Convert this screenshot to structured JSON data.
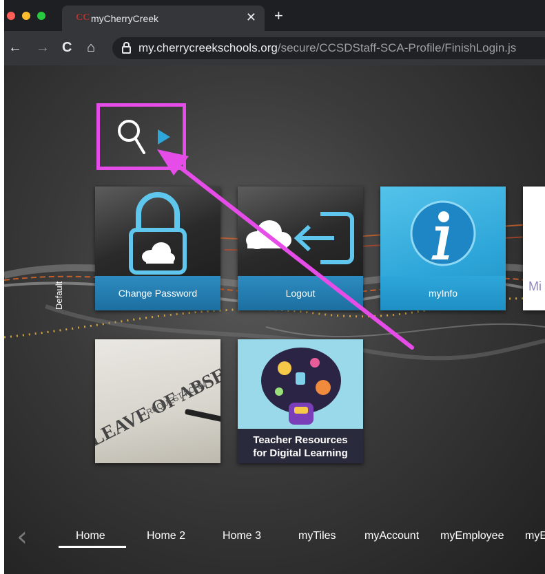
{
  "browser": {
    "tab_title": "myCherryCreek",
    "tab_favicon": "CC",
    "close_glyph": "✕",
    "newtab_glyph": "+",
    "back_glyph": "←",
    "forward_glyph": "→",
    "reload_glyph": "C",
    "home_glyph": "⌂",
    "url_host": "my.cherrycreekschools.org",
    "url_path": "/secure/CCSDStaff-SCA-Profile/FinishLogin.js"
  },
  "colors": {
    "highlight": "#e64ce8",
    "tile_blue": "#2ea6d9",
    "caption_blue": "#1c6fa0"
  },
  "sidebar": {
    "default_label": "Default"
  },
  "tiles": [
    {
      "label": "Change Password",
      "icon": "lock-cloud-icon"
    },
    {
      "label": "Logout",
      "icon": "cloud-logout-icon"
    },
    {
      "label": "myInfo",
      "icon": "info-icon"
    },
    {
      "label": "Mi",
      "icon": ""
    },
    {
      "label": "",
      "image_text": "LEAVE OF ABSENCE",
      "image_sub": "REQUEST FORM"
    },
    {
      "label": "Teacher Resources for Digital Learning",
      "line1": "Teacher Resources",
      "line2": "for Digital Learning"
    }
  ],
  "nav": {
    "items": [
      "Home",
      "Home 2",
      "Home 3",
      "myTiles",
      "myAccount",
      "myEmployee",
      "myE"
    ],
    "active": "Home",
    "prev_glyph": "‹"
  }
}
